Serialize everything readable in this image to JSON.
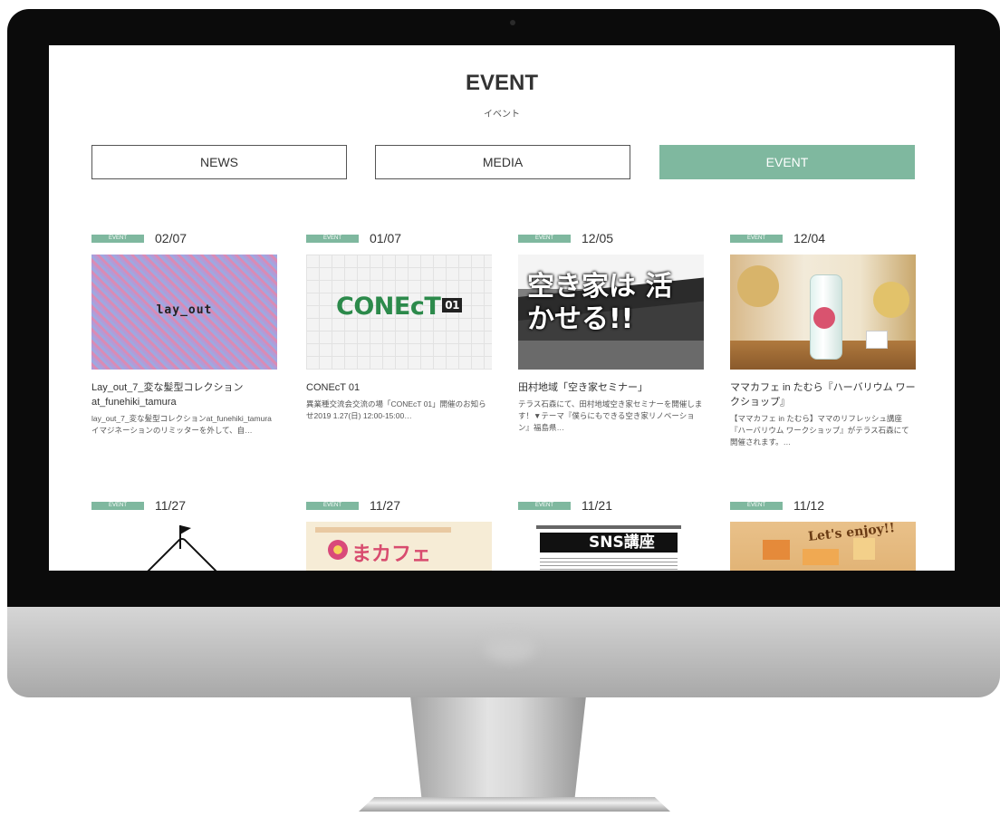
{
  "page": {
    "title": "EVENT",
    "subtitle": "イベント"
  },
  "tabs": [
    {
      "label": "NEWS",
      "active": false
    },
    {
      "label": "MEDIA",
      "active": false
    },
    {
      "label": "EVENT",
      "active": true
    }
  ],
  "colors": {
    "accent": "#7fb89f",
    "text": "#333333"
  },
  "cards": [
    {
      "badge": "EVENT",
      "date": "02/07",
      "thumb_text": "lay_out",
      "title": "Lay_out_7_変な髪型コレクションat_funehiki_tamura",
      "desc": "lay_out_7_変な髪型コレクションat_funehiki_tamuraイマジネーションのリミッターを外して、自…"
    },
    {
      "badge": "EVENT",
      "date": "01/07",
      "thumb_text": "CONEcT",
      "thumb_num": "01",
      "title": "CONEcT 01",
      "desc": "異業種交流会交流の場「CONEcT 01」開催のお知らせ2019 1.27(日) 12:00-15:00…"
    },
    {
      "badge": "EVENT",
      "date": "12/05",
      "thumb_text": "空き家は 活かせる!!",
      "title": "田村地域「空き家セミナー」",
      "desc": "テラス石森にて、田村地域空き家セミナーを開催します！▼テーマ『僕らにもできる空き家リノベーション』福島県…"
    },
    {
      "badge": "EVENT",
      "date": "12/04",
      "title": "ママカフェ in たむら『ハーバリウム ワークショップ』",
      "desc": "【ママカフェ in たむら】ママのリフレッシュ講座『ハーバリウム ワークショップ』がテラス石森にて開催されます。…"
    },
    {
      "badge": "EVENT",
      "date": "11/27"
    },
    {
      "badge": "EVENT",
      "date": "11/27",
      "thumb_text": "まカフェ"
    },
    {
      "badge": "EVENT",
      "date": "11/21",
      "thumb_text": "SNS講座"
    },
    {
      "badge": "EVENT",
      "date": "11/12",
      "thumb_text": "Let's enjoy!!"
    }
  ]
}
